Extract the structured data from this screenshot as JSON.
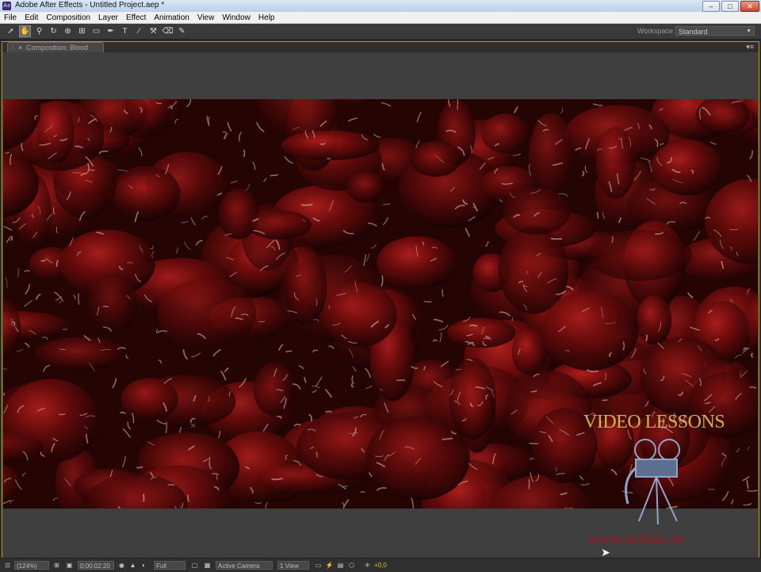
{
  "window": {
    "title": "Adobe After Effects - Untitled Project.aep *",
    "app_icon": "Ae",
    "buttons": {
      "minimize": "–",
      "maximize": "□",
      "close": "✕"
    }
  },
  "menu": [
    "File",
    "Edit",
    "Composition",
    "Layer",
    "Effect",
    "Animation",
    "View",
    "Window",
    "Help"
  ],
  "toolbar": {
    "tools": [
      {
        "name": "selection-tool-icon",
        "glyph": "➚"
      },
      {
        "name": "hand-tool-icon",
        "glyph": "✋"
      },
      {
        "name": "zoom-tool-icon",
        "glyph": "⚲"
      },
      {
        "name": "rotation-tool-icon",
        "glyph": "↻"
      },
      {
        "name": "camera-tool-icon",
        "glyph": "⊕"
      },
      {
        "name": "pan-behind-tool-icon",
        "glyph": "⊞"
      },
      {
        "name": "rectangle-tool-icon",
        "glyph": "▭"
      },
      {
        "name": "pen-tool-icon",
        "glyph": "✒"
      },
      {
        "name": "type-tool-icon",
        "glyph": "T"
      },
      {
        "name": "brush-tool-icon",
        "glyph": "∕"
      },
      {
        "name": "clone-stamp-tool-icon",
        "glyph": "⚒"
      },
      {
        "name": "eraser-tool-icon",
        "glyph": "⌫"
      },
      {
        "name": "puppet-tool-icon",
        "glyph": "✎"
      }
    ],
    "workspace_label": "Workspace:",
    "workspace_value": "Standard"
  },
  "panel": {
    "tab_label": "Composition: Blood",
    "close_glyph": "×",
    "menu_glyph": "▾≡"
  },
  "watermark": {
    "title": "VIDEO LESSONS",
    "url": "www.avdata.ru"
  },
  "status_bar": {
    "magnification": "(124%)",
    "timecode": "0:00:02:20",
    "resolution": "Full",
    "camera": "Active Camera",
    "views": "1 View",
    "exposure": "+0,0"
  },
  "colors": {
    "panel_border": "#c8960c",
    "blood_dark": "#2a0505",
    "blood_mid": "#7a1010",
    "watermark_title": "#c9b455",
    "watermark_url": "#a0141a"
  }
}
